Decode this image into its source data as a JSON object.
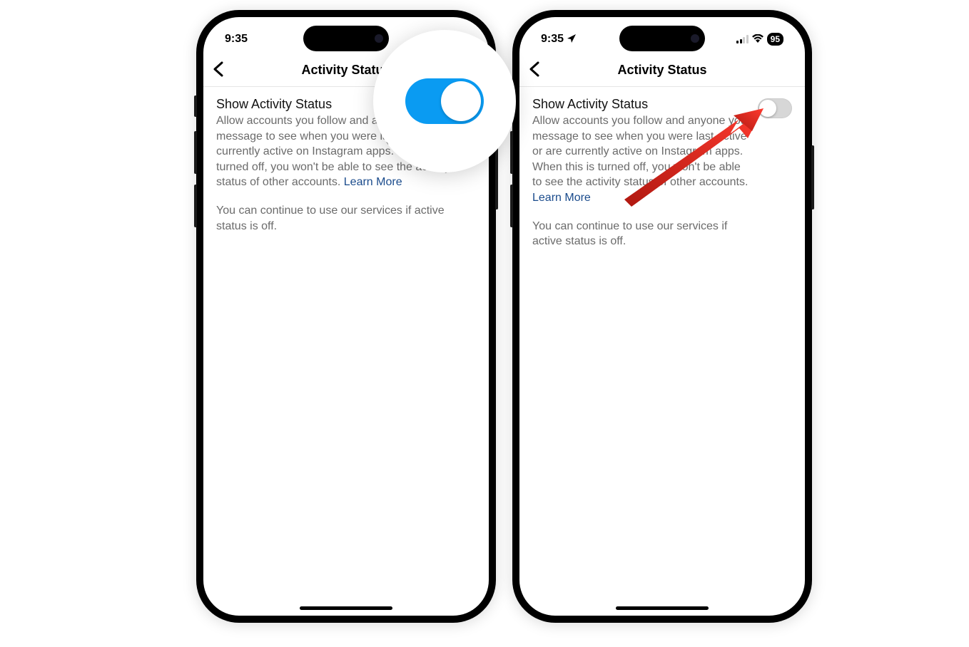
{
  "status": {
    "time": "9:35",
    "battery": "95"
  },
  "header": {
    "title": "Activity Status"
  },
  "setting": {
    "title": "Show Activity Status",
    "description_line": "Allow accounts you follow and anyone you message to see when you were last active or are currently active on Instagram apps. When this is turned off, you won't be able to see the activity status of other accounts.",
    "learn_more": "Learn More",
    "note": "You can continue to use our services if active status is off."
  },
  "toggle_states": {
    "left_phone": "on",
    "right_phone": "off"
  }
}
